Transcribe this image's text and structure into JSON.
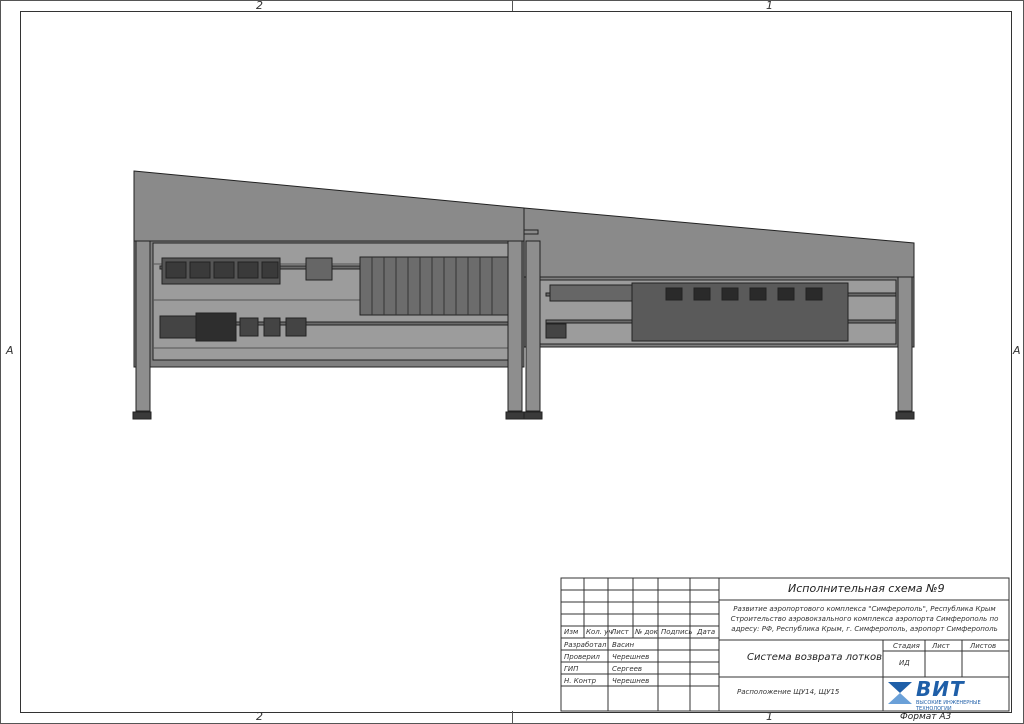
{
  "zones": {
    "top_left": "2",
    "top_right": "1",
    "bottom_left": "2",
    "bottom_right": "1",
    "row_left": "A",
    "row_right": "A"
  },
  "title_block": {
    "doc_title": "Исполнительная схема №9",
    "project_line1": "Развитие аэропортового комплекса \"Симферополь\", Республика Крым",
    "project_line2": "Строительство аэровокзального комплекса аэропорта Симферополь по",
    "project_line3": "адресу: РФ, Республика Крым, г. Симферополь, аэропорт Симферополь",
    "headers": {
      "izm": "Изм",
      "kol": "Кол. уч",
      "list": "Лист",
      "ndok": "№ док",
      "podpis": "Подпись",
      "data": "Дата"
    },
    "roles": [
      {
        "role": "Разработал",
        "name": "Васин"
      },
      {
        "role": "Проверил",
        "name": "Черешнев"
      },
      {
        "role": "ГИП",
        "name": "Сергеев"
      },
      {
        "role": "Н. Контр",
        "name": "Черешнев"
      }
    ],
    "system_name": "Система возврата лотков",
    "stage_label": "Стадия",
    "sheet_label": "Лист",
    "sheets_label": "Листов",
    "stage_value": "ИД",
    "layout_name": "Расположение ЩУ14, ЩУ15",
    "format": "Формат А3",
    "logo": {
      "text": "ВИТ",
      "subtitle": "высокие инженерные технологии",
      "color": "#1f5fa8"
    }
  },
  "colors": {
    "cabinet": "#8a8a8a",
    "cabinet_dark": "#5a5a5a",
    "panel_bg": "#9c9c9c",
    "line": "#222222"
  }
}
